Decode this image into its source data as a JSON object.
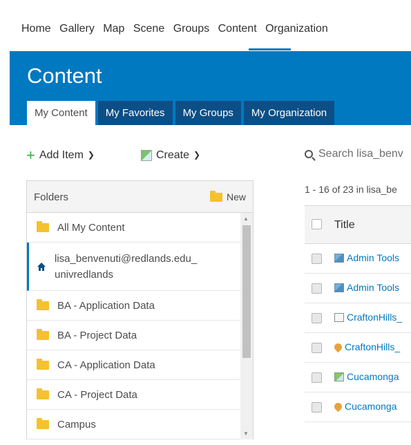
{
  "nav": {
    "links": [
      "Home",
      "Gallery",
      "Map",
      "Scene",
      "Groups",
      "Content",
      "Organization"
    ],
    "active": "Content"
  },
  "banner": {
    "title": "Content",
    "tabs": [
      "My Content",
      "My Favorites",
      "My Groups",
      "My Organization"
    ],
    "active_tab": "My Content"
  },
  "toolbar": {
    "add_item": "Add Item",
    "create": "Create"
  },
  "folders": {
    "header": "Folders",
    "new_label": "New",
    "items": [
      {
        "label": "All My Content",
        "icon": "folder-open-icon"
      },
      {
        "label": "lisa_benvenuti@redlands.edu_",
        "label2": "univredlands",
        "icon": "home-icon"
      },
      {
        "label": "BA - Application Data",
        "icon": "folder-icon"
      },
      {
        "label": "BA - Project Data",
        "icon": "folder-icon"
      },
      {
        "label": "CA - Application Data",
        "icon": "folder-icon"
      },
      {
        "label": "CA - Project Data",
        "icon": "folder-icon"
      },
      {
        "label": "Campus",
        "icon": "folder-icon"
      }
    ]
  },
  "search": {
    "placeholder": "Search lisa_benv"
  },
  "results": {
    "count_text": "1 - 16 of 23 in lisa_be",
    "title_header": "Title",
    "rows": [
      {
        "title": "Admin Tools",
        "icon": "map-icon"
      },
      {
        "title": "Admin Tools",
        "icon": "map-icon"
      },
      {
        "title": "CraftonHills_",
        "icon": "document-icon"
      },
      {
        "title": "CraftonHills_",
        "icon": "pin-icon"
      },
      {
        "title": "Cucamonga",
        "icon": "scene-icon"
      },
      {
        "title": "Cucamonga",
        "icon": "pin-icon"
      }
    ]
  },
  "colors": {
    "brand": "#0079c1",
    "add": "#35ac46"
  }
}
